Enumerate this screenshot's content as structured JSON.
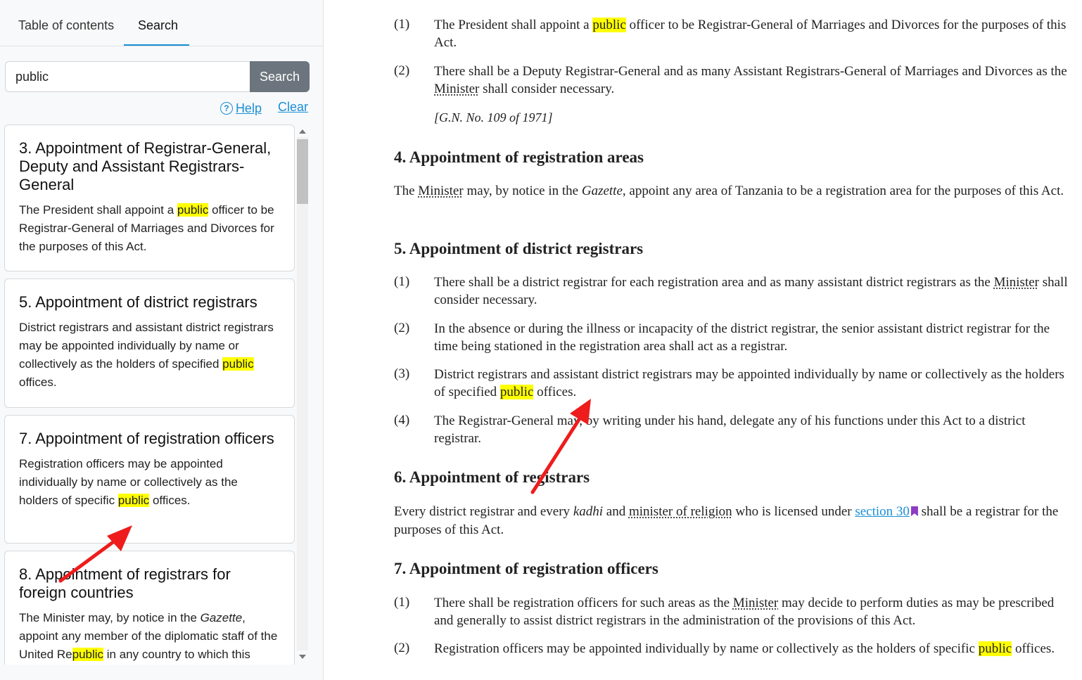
{
  "sidebar": {
    "tabs": [
      {
        "label": "Table of contents"
      },
      {
        "label": "Search"
      }
    ],
    "search": {
      "value": "public",
      "placeholder": "",
      "button_label": "Search"
    },
    "help_label": "Help",
    "clear_label": "Clear",
    "results": [
      {
        "title": "3. Appointment of Registrar-General, Deputy and Assistant Registrars-General",
        "before": "The President shall appoint a ",
        "match": "public",
        "after": " officer to be Registrar-General of Marriages and Divorces for the purposes of this Act."
      },
      {
        "title": "5. Appointment of district registrars",
        "before": "District registrars and assistant district registrars may be appointed individually by name or collectively as the holders of specified ",
        "match": "public",
        "after": " offices."
      },
      {
        "title": "7. Appointment of registration officers",
        "before": "Registration officers may be appointed individually by name or collectively as the holders of specific ",
        "match": "public",
        "after": " offices."
      },
      {
        "title": "8. Appointment of registrars for foreign countries",
        "before": "The Minister may, by notice in the ",
        "gazette": "Gazette",
        "before2": ", appoint any member of the diplomatic staff of the United Re",
        "match": "public",
        "after": " in any country to which this"
      }
    ]
  },
  "document": {
    "s3": {
      "p1_num": "(1)",
      "p1_before": "The President shall appoint a ",
      "p1_match": "public",
      "p1_after": " officer to be Registrar-General of Marriages and Divorces for the purposes of this Act.",
      "p2_num": "(2)",
      "p2_before": "There shall be a Deputy Registrar-General and as many Assistant Registrars-General of Marriages and Divorces as the ",
      "p2_term": "Minister",
      "p2_after": " shall consider necessary.",
      "note": "[G.N. No. 109 of 1971]"
    },
    "s4": {
      "heading": "4. Appointment of registration areas",
      "text_a": "The ",
      "term": "Minister",
      "text_b": " may, by notice in the ",
      "gazette": "Gazette",
      "text_c": ", appoint any area of Tanzania to be a registration area for the purposes of this Act."
    },
    "s5": {
      "heading": "5. Appointment of district registrars",
      "p1_num": "(1)",
      "p1_before": "There shall be a district registrar for each registration area and as many assistant district registrars as the ",
      "p1_term": "Minister",
      "p1_after": " shall consider necessary.",
      "p2_num": "(2)",
      "p2": "In the absence or during the illness or incapacity of the district registrar, the senior assistant district registrar for the time being stationed in the registration area shall act as a registrar.",
      "p3_num": "(3)",
      "p3_before": "District registrars and assistant district registrars may be appointed individually by name or collectively as the holders of specified ",
      "p3_match": "public",
      "p3_after": " offices.",
      "p4_num": "(4)",
      "p4": "The Registrar-General may, by writing under his hand, delegate any of his functions under this Act to a district registrar."
    },
    "s6": {
      "heading": "6. Appointment of registrars",
      "text_a": "Every district registrar and every ",
      "kadhi": "kadhi",
      "text_b": " and ",
      "term": "minister of religion",
      "text_c": " who is licensed under ",
      "link": "section 30",
      "text_d": " shall be a registrar for the purposes of this Act."
    },
    "s7": {
      "heading": "7. Appointment of registration officers",
      "p1_num": "(1)",
      "p1_before": "There shall be registration officers for such areas as the ",
      "p1_term": "Minister",
      "p1_after": " may decide to perform duties as may be prescribed and generally to assist district registrars in the administration of the provisions of this Act.",
      "p2_num": "(2)",
      "p2_before": "Registration officers may be appointed individually by name or collectively as the holders of specific ",
      "p2_match": "public",
      "p2_after": " offices."
    }
  },
  "annotations": {
    "arrow_color": "#ee1c1c"
  },
  "colors": {
    "highlight": "#ffff00",
    "accent": "#1a8fd6",
    "search_button": "#6c757d",
    "bookmark": "#8e3cc4"
  }
}
